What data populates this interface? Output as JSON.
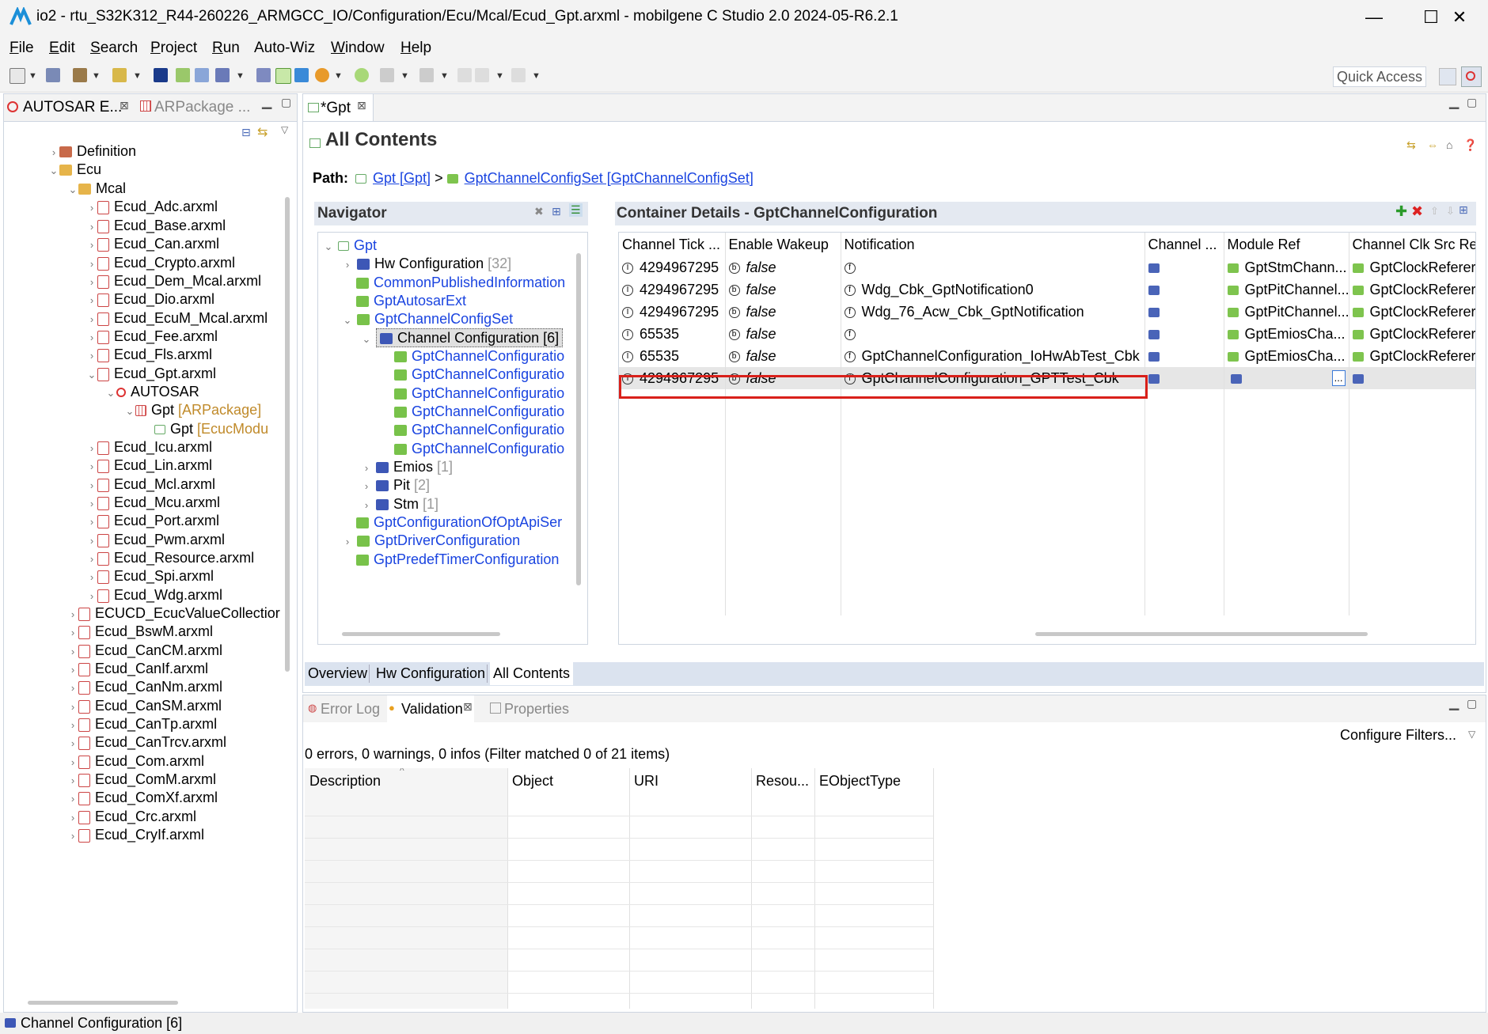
{
  "window": {
    "title": "io2 - rtu_S32K312_R44-260226_ARMGCC_IO/Configuration/Ecu/Mcal/Ecud_Gpt.arxml - mobilgene C Studio 2.0 2024-05-R6.2.1",
    "minimize": "—",
    "maximize": "☐",
    "close": "✕"
  },
  "menu": [
    {
      "first": "F",
      "rest": "ile"
    },
    {
      "first": "E",
      "rest": "dit"
    },
    {
      "first": "S",
      "rest": "earch"
    },
    {
      "first": "P",
      "rest": "roject"
    },
    {
      "first": "R",
      "rest": "un"
    },
    {
      "first": "",
      "rest": "Auto-Wiz"
    },
    {
      "first": "W",
      "rest": "indow"
    },
    {
      "first": "H",
      "rest": "elp"
    }
  ],
  "quick_access": "Quick Access",
  "left": {
    "tab1": "AUTOSAR E...",
    "tab2": "ARPackage ...",
    "tree": [
      {
        "label": "Definition",
        "extra": ""
      },
      {
        "label": "Ecu",
        "extra": ""
      },
      {
        "label": "Mcal",
        "extra": ""
      },
      {
        "label": "Ecud_Adc.arxml",
        "extra": ""
      },
      {
        "label": "Ecud_Base.arxml",
        "extra": ""
      },
      {
        "label": "Ecud_Can.arxml",
        "extra": ""
      },
      {
        "label": "Ecud_Crypto.arxml",
        "extra": ""
      },
      {
        "label": "Ecud_Dem_Mcal.arxml",
        "extra": ""
      },
      {
        "label": "Ecud_Dio.arxml",
        "extra": ""
      },
      {
        "label": "Ecud_EcuM_Mcal.arxml",
        "extra": ""
      },
      {
        "label": "Ecud_Fee.arxml",
        "extra": ""
      },
      {
        "label": "Ecud_Fls.arxml",
        "extra": ""
      },
      {
        "label": "Ecud_Gpt.arxml",
        "extra": ""
      },
      {
        "label": "AUTOSAR",
        "extra": ""
      },
      {
        "label": "Gpt",
        "extra": "[ARPackage]"
      },
      {
        "label": "Gpt",
        "extra": "[EcucModu"
      },
      {
        "label": "Ecud_Icu.arxml",
        "extra": ""
      },
      {
        "label": "Ecud_Lin.arxml",
        "extra": ""
      },
      {
        "label": "Ecud_Mcl.arxml",
        "extra": ""
      },
      {
        "label": "Ecud_Mcu.arxml",
        "extra": ""
      },
      {
        "label": "Ecud_Port.arxml",
        "extra": ""
      },
      {
        "label": "Ecud_Pwm.arxml",
        "extra": ""
      },
      {
        "label": "Ecud_Resource.arxml",
        "extra": ""
      },
      {
        "label": "Ecud_Spi.arxml",
        "extra": ""
      },
      {
        "label": "Ecud_Wdg.arxml",
        "extra": ""
      },
      {
        "label": "ECUCD_EcucValueCollectior",
        "extra": ""
      },
      {
        "label": "Ecud_BswM.arxml",
        "extra": ""
      },
      {
        "label": "Ecud_CanCM.arxml",
        "extra": ""
      },
      {
        "label": "Ecud_CanIf.arxml",
        "extra": ""
      },
      {
        "label": "Ecud_CanNm.arxml",
        "extra": ""
      },
      {
        "label": "Ecud_CanSM.arxml",
        "extra": ""
      },
      {
        "label": "Ecud_CanTp.arxml",
        "extra": ""
      },
      {
        "label": "Ecud_CanTrcv.arxml",
        "extra": ""
      },
      {
        "label": "Ecud_Com.arxml",
        "extra": ""
      },
      {
        "label": "Ecud_ComM.arxml",
        "extra": ""
      },
      {
        "label": "Ecud_ComXf.arxml",
        "extra": ""
      },
      {
        "label": "Ecud_Crc.arxml",
        "extra": ""
      },
      {
        "label": "Ecud_CryIf.arxml",
        "extra": ""
      }
    ]
  },
  "editor": {
    "tab": "*Gpt",
    "heading": "All Contents",
    "path_label": "Path:",
    "path1": "Gpt [Gpt]",
    "path_sep": ">",
    "path2": "GptChannelConfigSet [GptChannelConfigSet]",
    "navigator": {
      "title": "Navigator",
      "items": [
        {
          "label": "Gpt",
          "extra": ""
        },
        {
          "label": "Hw Configuration",
          "extra": "[32]"
        },
        {
          "label": "CommonPublishedInformation",
          "extra": ""
        },
        {
          "label": "GptAutosarExt",
          "extra": ""
        },
        {
          "label": "GptChannelConfigSet",
          "extra": ""
        },
        {
          "label": "Channel Configuration [6]",
          "extra": ""
        },
        {
          "label": "GptChannelConfiguratio",
          "extra": ""
        },
        {
          "label": "GptChannelConfiguratio",
          "extra": ""
        },
        {
          "label": "GptChannelConfiguratio",
          "extra": ""
        },
        {
          "label": "GptChannelConfiguratio",
          "extra": ""
        },
        {
          "label": "GptChannelConfiguratio",
          "extra": ""
        },
        {
          "label": "GptChannelConfiguratio",
          "extra": ""
        },
        {
          "label": "Emios",
          "extra": "[1]"
        },
        {
          "label": "Pit",
          "extra": "[2]"
        },
        {
          "label": "Stm",
          "extra": "[1]"
        },
        {
          "label": "GptConfigurationOfOptApiSer",
          "extra": ""
        },
        {
          "label": "GptDriverConfiguration",
          "extra": ""
        },
        {
          "label": "GptPredefTimerConfiguration",
          "extra": ""
        }
      ]
    },
    "details": {
      "title": "Container Details - GptChannelConfiguration",
      "columns": [
        "Channel Tick ...",
        "Enable Wakeup",
        "Notification",
        "Channel ...",
        "Module Ref",
        "Channel Clk Src Re"
      ],
      "rows": [
        {
          "tick": "4294967295",
          "wakeup": "false",
          "notif": "",
          "module": "GptStmChann...",
          "clk": "GptClockReferer"
        },
        {
          "tick": "4294967295",
          "wakeup": "false",
          "notif": "Wdg_Cbk_GptNotification0",
          "module": "GptPitChannel...",
          "clk": "GptClockReferer"
        },
        {
          "tick": "4294967295",
          "wakeup": "false",
          "notif": "Wdg_76_Acw_Cbk_GptNotification",
          "module": "GptPitChannel...",
          "clk": "GptClockReferer"
        },
        {
          "tick": "65535",
          "wakeup": "false",
          "notif": "",
          "module": "GptEmiosCha...",
          "clk": "GptClockReferer"
        },
        {
          "tick": "65535",
          "wakeup": "false",
          "notif": "GptChannelConfiguration_IoHwAbTest_Cbk",
          "module": "GptEmiosCha...",
          "clk": "GptClockReferer"
        },
        {
          "tick": "4294967295",
          "wakeup": "false",
          "notif": "GptChannelConfiguration_GPTTest_Cbk",
          "module": "",
          "clk": ""
        }
      ],
      "ellipsis": "..."
    },
    "pages": [
      "Overview",
      "Hw Configuration",
      "All Contents"
    ]
  },
  "bottom": {
    "tabs": [
      "Error Log",
      "Validation",
      "Properties"
    ],
    "configure": "Configure Filters...",
    "summary": "0 errors, 0 warnings, 0 infos (Filter matched 0 of 21 items)",
    "columns": [
      "Description",
      "Object",
      "URI",
      "Resou...",
      "EObjectType"
    ]
  },
  "status": "Channel Configuration [6]"
}
